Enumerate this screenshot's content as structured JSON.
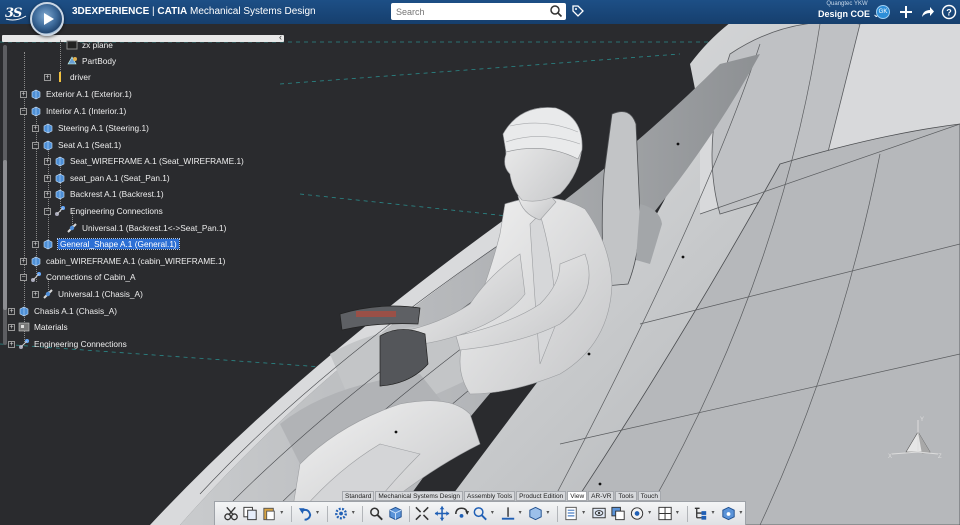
{
  "header": {
    "brand": "3DEXPERIENCE",
    "separator": " | ",
    "app": "CATIA",
    "app_subtitle": "Mechanical Systems Design",
    "search_placeholder": "Search",
    "user_name": "Quangtec YKW",
    "collab_space": "Design COE",
    "avatar_initials": "GK"
  },
  "tree": {
    "nodes": [
      {
        "label": "zx plane",
        "icon": "plane-icon"
      },
      {
        "label": "PartBody",
        "icon": "partbody-icon"
      },
      {
        "label": "driver",
        "icon": "driver-icon"
      },
      {
        "label": "Exterior A.1 (Exterior.1)",
        "icon": "product-icon"
      },
      {
        "label": "Interior A.1 (Interior.1)",
        "icon": "product-icon"
      },
      {
        "label": "Steering A.1 (Steering.1)",
        "icon": "product-icon"
      },
      {
        "label": "Seat A.1 (Seat.1)",
        "icon": "product-icon"
      },
      {
        "label": "Seat_WIREFRAME A.1 (Seat_WIREFRAME.1)",
        "icon": "product-icon"
      },
      {
        "label": "seat_pan A.1 (Seat_Pan.1)",
        "icon": "product-icon"
      },
      {
        "label": "Backrest A.1 (Backrest.1)",
        "icon": "product-icon"
      },
      {
        "label": "Engineering Connections",
        "icon": "connections-icon"
      },
      {
        "label": "Universal.1 (Backrest.1<->Seat_Pan.1)",
        "icon": "universal-joint-icon"
      },
      {
        "label": "General_Shape A.1 (General.1)",
        "icon": "product-icon",
        "selected": true
      },
      {
        "label": "cabin_WIREFRAME A.1 (cabin_WIREFRAME.1)",
        "icon": "product-icon"
      },
      {
        "label": "Connections of Cabin_A",
        "icon": "connections-icon"
      },
      {
        "label": "Universal.1 (Chasis_A)",
        "icon": "universal-joint-icon"
      },
      {
        "label": "Chasis A.1 (Chasis_A)",
        "icon": "product-icon"
      },
      {
        "label": "Materials",
        "icon": "materials-icon"
      },
      {
        "label": "Engineering Connections",
        "icon": "connections-icon"
      }
    ]
  },
  "action_bar": {
    "tabs": [
      {
        "label": "Standard",
        "active": false
      },
      {
        "label": "Mechanical Systems Design",
        "active": false
      },
      {
        "label": "Assembly Tools",
        "active": false
      },
      {
        "label": "Product Edition",
        "active": false
      },
      {
        "label": "View",
        "active": true
      },
      {
        "label": "AR-VR",
        "active": false
      },
      {
        "label": "Tools",
        "active": false
      },
      {
        "label": "Touch",
        "active": false
      }
    ],
    "tools": [
      "cut-icon",
      "copy-icon",
      "paste-icon",
      "undo-icon",
      "settings-icon",
      "search-icon",
      "cube-view-icon",
      "fit-all-icon",
      "pan-icon",
      "rotate-icon",
      "zoom-icon",
      "normal-view-icon",
      "iso-view-icon",
      "render-style-icon",
      "hide-show-icon",
      "swap-visible-icon",
      "capture-icon",
      "multi-view-icon",
      "tree-icon",
      "3d-view-icon"
    ]
  },
  "colors": {
    "topbar": "#1d4f86",
    "viewport_bg": "#2a2b2e",
    "selection": "#2c6fd4"
  }
}
